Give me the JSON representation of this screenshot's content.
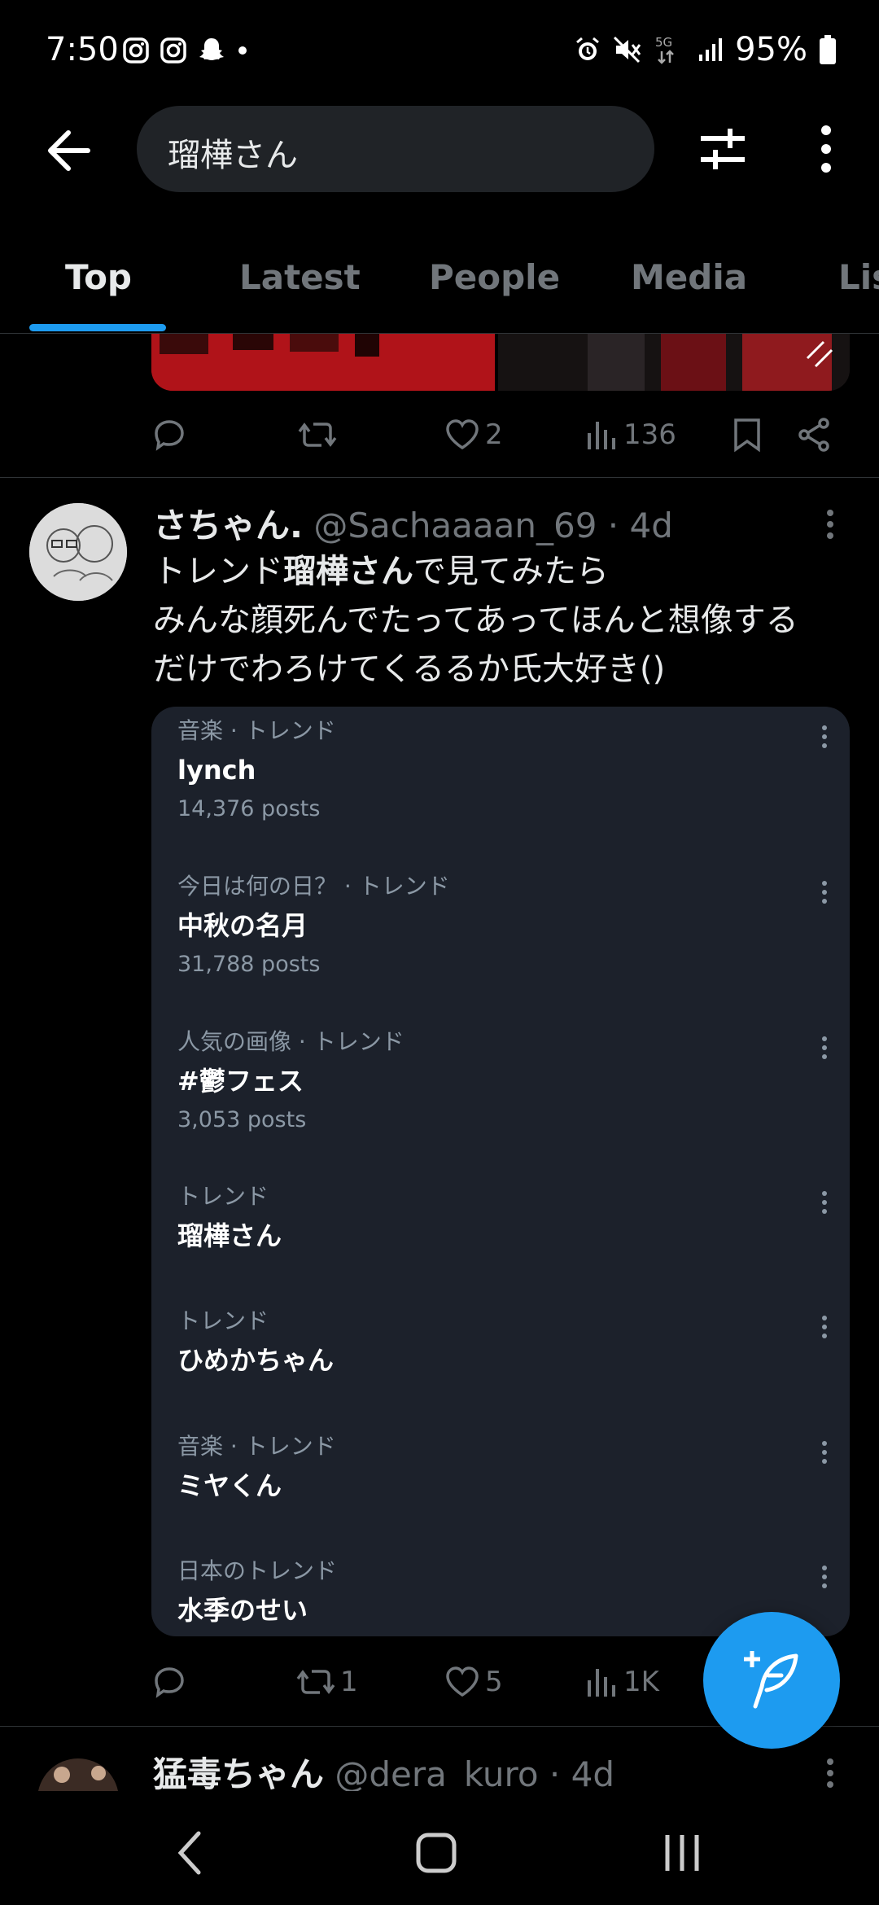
{
  "status_bar": {
    "time": "7:50",
    "battery": "95%",
    "network": "5G"
  },
  "search": {
    "query": "瑠樺さん"
  },
  "tabs": [
    "Top",
    "Latest",
    "People",
    "Media",
    "Lis"
  ],
  "active_tab": "Top",
  "prev_tweet_actions": {
    "reply": "",
    "retweet": "",
    "like": "2",
    "views": "136"
  },
  "tweet": {
    "name": "さちゃん.",
    "handle_time": "@Sachaaaan_69 · 4d",
    "text_prefix": "トレンド",
    "text_highlight": "瑠樺さん",
    "text_rest": "で見てみたら",
    "text_line2": "みんな顔死んでたってあってほんと想像する",
    "text_line3": "だけでわろけてくるるか氏大好き()",
    "trends": [
      {
        "category": "音楽 · トレンド",
        "name": "lynch",
        "count": "14,376 posts"
      },
      {
        "category": "今日は何の日？ · トレンド",
        "name": "中秋の名月",
        "count": "31,788 posts"
      },
      {
        "category": "人気の画像 · トレンド",
        "name": "#鬱フェス",
        "count": "3,053 posts"
      },
      {
        "category": "トレンド",
        "name": "瑠樺さん",
        "count": ""
      },
      {
        "category": "トレンド",
        "name": "ひめかちゃん",
        "count": ""
      },
      {
        "category": "音楽 · トレンド",
        "name": "ミヤくん",
        "count": ""
      },
      {
        "category": "日本のトレンド",
        "name": "水季のせい",
        "count": ""
      }
    ],
    "actions": {
      "reply": "",
      "retweet": "1",
      "like": "5",
      "views": "1K"
    }
  },
  "next_tweet": {
    "name": "猛毒ちゃん",
    "handle_time": "@dera_kuro · 4d"
  },
  "colors": {
    "accent": "#1d9bf0",
    "background": "#000000",
    "card": "#1c212b",
    "muted": "#71767b"
  }
}
